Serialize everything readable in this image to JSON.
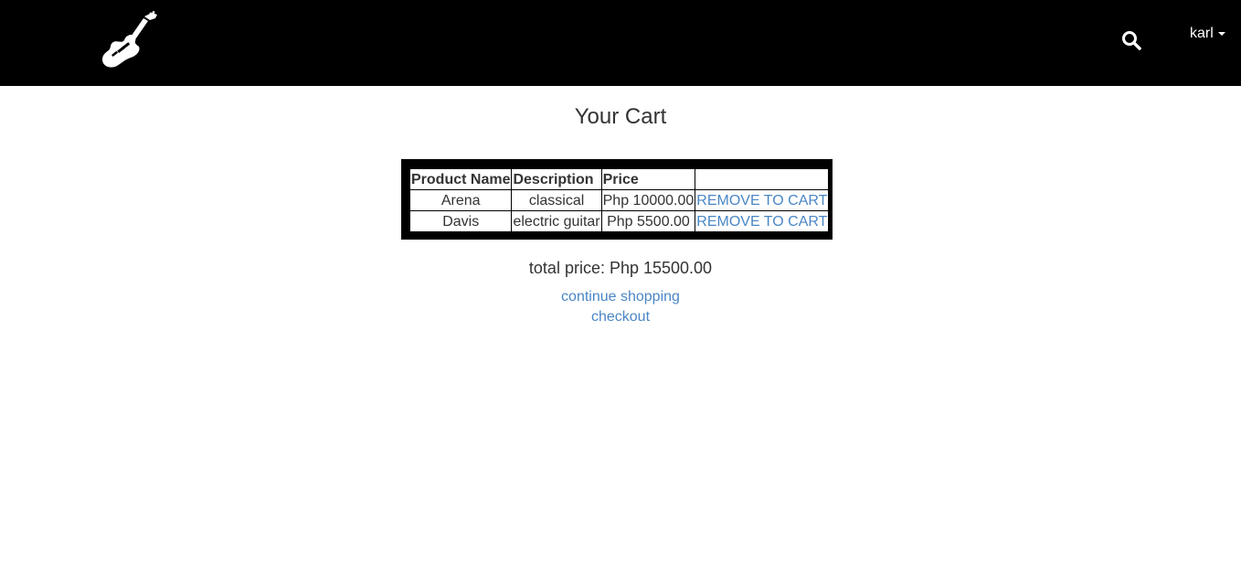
{
  "header": {
    "brand_icon": "electric-guitar-logo",
    "search_icon": "search-icon",
    "user": {
      "name": "karl"
    },
    "colors": {
      "background": "#000000",
      "foreground": "#ffffff"
    }
  },
  "main": {
    "title": "Your Cart",
    "table": {
      "columns": [
        "Product Name",
        "Description",
        "Price",
        ""
      ],
      "rows": [
        {
          "name": "Arena",
          "description": "classical",
          "price": "Php 10000.00",
          "action": "REMOVE TO CART"
        },
        {
          "name": "Davis",
          "description": "electric guitar",
          "price": "Php 5500.00",
          "action": "REMOVE TO CART"
        }
      ]
    },
    "total": "total price: Php 15500.00",
    "links": {
      "continue": "continue shopping",
      "checkout": "checkout"
    },
    "colors": {
      "link": "#4a86c5",
      "text": "#333333"
    }
  }
}
